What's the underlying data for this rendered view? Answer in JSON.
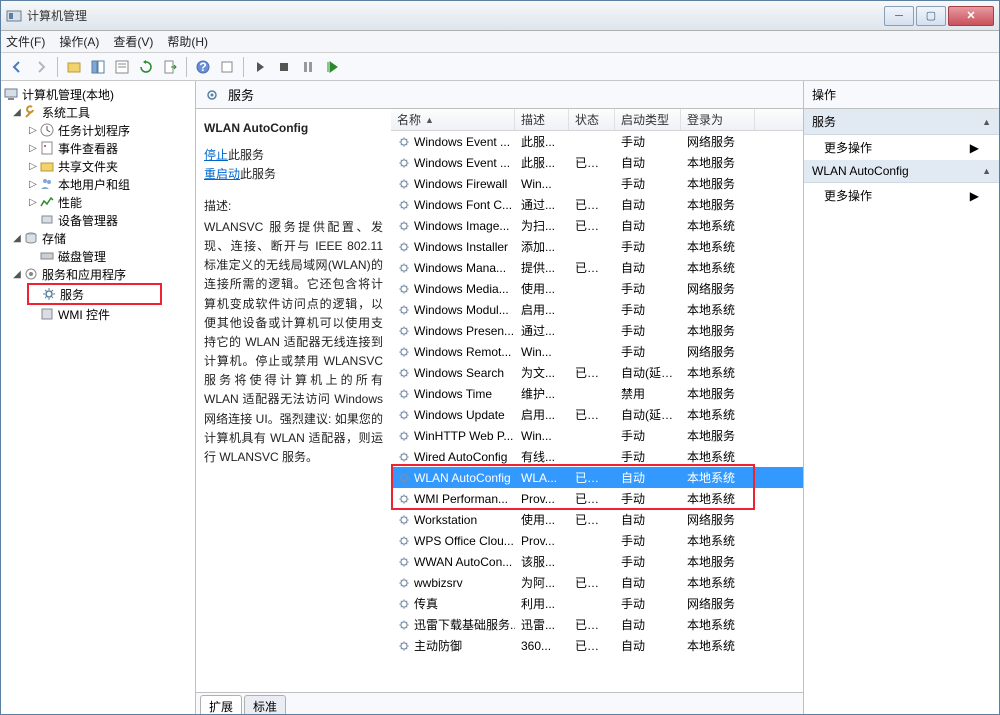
{
  "window": {
    "title": "计算机管理"
  },
  "menus": {
    "file": "文件(F)",
    "action": "操作(A)",
    "view": "查看(V)",
    "help": "帮助(H)"
  },
  "tree": {
    "root": "计算机管理(本地)",
    "systools": "系统工具",
    "taskscheduler": "任务计划程序",
    "eventviewer": "事件查看器",
    "sharedfolders": "共享文件夹",
    "localusers": "本地用户和组",
    "performance": "性能",
    "devicemgr": "设备管理器",
    "storage": "存储",
    "diskmgmt": "磁盘管理",
    "servicesapps": "服务和应用程序",
    "services": "服务",
    "wmi": "WMI 控件"
  },
  "mid": {
    "header": "服务"
  },
  "details": {
    "name": "WLAN AutoConfig",
    "stop_label_pre": "停止",
    "stop_label_post": "此服务",
    "restart_label_pre": "重启动",
    "restart_label_post": "此服务",
    "desc_label": "描述:",
    "desc": "WLANSVC 服务提供配置、发现、连接、断开与 IEEE 802.11 标准定义的无线局域网(WLAN)的连接所需的逻辑。它还包含将计算机变成软件访问点的逻辑，以便其他设备或计算机可以使用支持它的 WLAN 适配器无线连接到计算机。停止或禁用 WLANSVC 服务将使得计算机上的所有 WLAN 适配器无法访问 Windows 网络连接 UI。强烈建议: 如果您的计算机具有 WLAN 适配器，则运行 WLANSVC 服务。"
  },
  "columns": {
    "name": "名称",
    "desc": "描述",
    "status": "状态",
    "startup": "启动类型",
    "logon": "登录为"
  },
  "services": [
    {
      "name": "Windows Event ...",
      "desc": "此服...",
      "status": "",
      "startup": "手动",
      "logon": "网络服务"
    },
    {
      "name": "Windows Event ...",
      "desc": "此服...",
      "status": "已启动",
      "startup": "自动",
      "logon": "本地服务"
    },
    {
      "name": "Windows Firewall",
      "desc": "Win...",
      "status": "",
      "startup": "手动",
      "logon": "本地服务"
    },
    {
      "name": "Windows Font C...",
      "desc": "通过...",
      "status": "已启动",
      "startup": "自动",
      "logon": "本地服务"
    },
    {
      "name": "Windows Image...",
      "desc": "为扫...",
      "status": "已启动",
      "startup": "自动",
      "logon": "本地系统"
    },
    {
      "name": "Windows Installer",
      "desc": "添加...",
      "status": "",
      "startup": "手动",
      "logon": "本地系统"
    },
    {
      "name": "Windows Mana...",
      "desc": "提供...",
      "status": "已启动",
      "startup": "自动",
      "logon": "本地系统"
    },
    {
      "name": "Windows Media...",
      "desc": "使用...",
      "status": "",
      "startup": "手动",
      "logon": "网络服务"
    },
    {
      "name": "Windows Modul...",
      "desc": "启用...",
      "status": "",
      "startup": "手动",
      "logon": "本地系统"
    },
    {
      "name": "Windows Presen...",
      "desc": "通过...",
      "status": "",
      "startup": "手动",
      "logon": "本地服务"
    },
    {
      "name": "Windows Remot...",
      "desc": "Win...",
      "status": "",
      "startup": "手动",
      "logon": "网络服务"
    },
    {
      "name": "Windows Search",
      "desc": "为文...",
      "status": "已启动",
      "startup": "自动(延迟...",
      "logon": "本地系统"
    },
    {
      "name": "Windows Time",
      "desc": "维护...",
      "status": "",
      "startup": "禁用",
      "logon": "本地服务"
    },
    {
      "name": "Windows Update",
      "desc": "启用...",
      "status": "已启动",
      "startup": "自动(延迟...",
      "logon": "本地系统"
    },
    {
      "name": "WinHTTP Web P...",
      "desc": "Win...",
      "status": "",
      "startup": "手动",
      "logon": "本地服务"
    },
    {
      "name": "Wired AutoConfig",
      "desc": "有线...",
      "status": "",
      "startup": "手动",
      "logon": "本地系统"
    },
    {
      "name": "WLAN AutoConfig",
      "desc": "WLA...",
      "status": "已启动",
      "startup": "自动",
      "logon": "本地系统",
      "selected": true
    },
    {
      "name": "WMI Performan...",
      "desc": "Prov...",
      "status": "已启动",
      "startup": "手动",
      "logon": "本地系统"
    },
    {
      "name": "Workstation",
      "desc": "使用...",
      "status": "已启动",
      "startup": "自动",
      "logon": "网络服务"
    },
    {
      "name": "WPS Office Clou...",
      "desc": "Prov...",
      "status": "",
      "startup": "手动",
      "logon": "本地系统"
    },
    {
      "name": "WWAN AutoCon...",
      "desc": "该服...",
      "status": "",
      "startup": "手动",
      "logon": "本地服务"
    },
    {
      "name": "wwbizsrv",
      "desc": "为阿...",
      "status": "已启动",
      "startup": "自动",
      "logon": "本地系统"
    },
    {
      "name": "传真",
      "desc": "利用...",
      "status": "",
      "startup": "手动",
      "logon": "网络服务"
    },
    {
      "name": "迅雷下载基础服务...",
      "desc": "迅雷...",
      "status": "已启动",
      "startup": "自动",
      "logon": "本地系统"
    },
    {
      "name": "主动防御",
      "desc": "360...",
      "status": "已启动",
      "startup": "自动",
      "logon": "本地系统"
    }
  ],
  "tabs": {
    "extended": "扩展",
    "standard": "标准"
  },
  "actions": {
    "title": "操作",
    "section1": "服务",
    "more": "更多操作",
    "section2": "WLAN AutoConfig"
  }
}
